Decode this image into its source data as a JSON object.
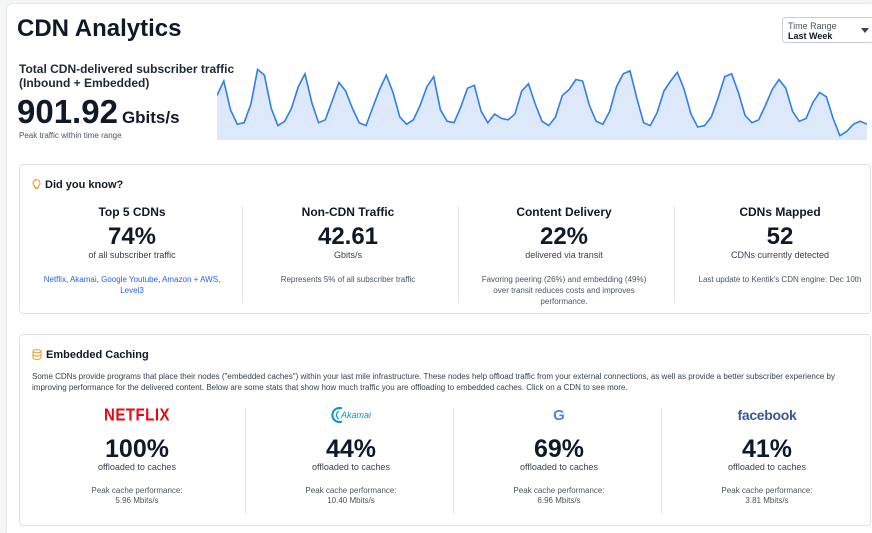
{
  "header": {
    "title": "CDN Analytics",
    "time_range": {
      "label": "Time Range",
      "value": "Last Week"
    }
  },
  "traffic": {
    "title_line1": "Total CDN-delivered subscriber traffic",
    "title_line2": "(Inbound + Embedded)",
    "value": "901.92",
    "unit": "Gbits/s",
    "caption": "Peak traffic within time range",
    "series": [
      0.62,
      0.82,
      0.42,
      0.22,
      0.24,
      0.5,
      0.98,
      0.9,
      0.44,
      0.2,
      0.26,
      0.44,
      0.74,
      0.92,
      0.52,
      0.24,
      0.28,
      0.54,
      0.8,
      0.68,
      0.44,
      0.24,
      0.2,
      0.45,
      0.7,
      0.9,
      0.66,
      0.32,
      0.22,
      0.28,
      0.48,
      0.74,
      0.88,
      0.42,
      0.26,
      0.24,
      0.46,
      0.72,
      0.76,
      0.4,
      0.24,
      0.36,
      0.3,
      0.28,
      0.36,
      0.68,
      0.78,
      0.5,
      0.26,
      0.2,
      0.32,
      0.62,
      0.7,
      0.84,
      0.82,
      0.48,
      0.26,
      0.22,
      0.4,
      0.74,
      0.92,
      0.96,
      0.58,
      0.24,
      0.2,
      0.38,
      0.68,
      0.82,
      0.94,
      0.7,
      0.36,
      0.18,
      0.2,
      0.32,
      0.58,
      0.88,
      0.92,
      0.66,
      0.34,
      0.24,
      0.28,
      0.48,
      0.7,
      0.84,
      0.72,
      0.4,
      0.26,
      0.3,
      0.52,
      0.66,
      0.6,
      0.3,
      0.06,
      0.12,
      0.22,
      0.26,
      0.22
    ],
    "colors": {
      "line": "#2f7fe6",
      "fill": "#dde9fb"
    }
  },
  "did_you_know": {
    "title": "Did you know?",
    "icon": "lightbulb-icon",
    "stats": [
      {
        "title": "Top 5 CDNs",
        "value": "74%",
        "sub": "of all subscriber traffic",
        "links": [
          {
            "label": "Netflix",
            "sep": ", "
          },
          {
            "label": "Akamai",
            "sep": ", "
          },
          {
            "label": "Google Youtube",
            "sep": ", "
          },
          {
            "label": "Amazon + AWS",
            "sep": ", "
          },
          {
            "label": "Level3",
            "sep": ""
          }
        ]
      },
      {
        "title": "Non-CDN Traffic",
        "value": "42.61",
        "sub": "Gbits/s",
        "desc": "Represents 5% of all subscriber traffic"
      },
      {
        "title": "Content Delivery",
        "value": "22%",
        "sub": "delivered via transit",
        "desc": "Favoring peering (26%) and embedding (49%) over transit reduces costs and improves performance."
      },
      {
        "title": "CDNs Mapped",
        "value": "52",
        "sub": "CDNs currently detected",
        "desc": "Last update to Kentik's CDN engine: Dec 10th"
      }
    ]
  },
  "embedded_caching": {
    "title": "Embedded Caching",
    "icon": "database-icon",
    "description": "Some CDNs provide programs that place their nodes (\"embedded caches\") within your last mile infrastructure. These nodes help offload traffic from your external connections, as well as provide a better subscriber experience by improving performance for the delivered content. Below are some stats that show how much traffic you are offloading to embedded caches. Click on a CDN to see more.",
    "cdns": [
      {
        "name": "netflix",
        "logo": "NETFLIX",
        "value": "100%",
        "sub": "offloaded to caches",
        "perf_label": "Peak cache performance:",
        "perf_value": "5.96 Mbits/s",
        "color": "#e50914"
      },
      {
        "name": "akamai",
        "logo": "Akamai",
        "value": "44%",
        "sub": "offloaded to caches",
        "perf_label": "Peak cache performance:",
        "perf_value": "10.40 Mbits/s",
        "color": "#0096d6"
      },
      {
        "name": "google",
        "logo": "G",
        "value": "69%",
        "sub": "offloaded to caches",
        "perf_label": "Peak cache performance:",
        "perf_value": "6.96 Mbits/s",
        "color": "#4285f4"
      },
      {
        "name": "facebook",
        "logo": "facebook",
        "value": "41%",
        "sub": "offloaded to caches",
        "perf_label": "Peak cache performance:",
        "perf_value": "3.81 Mbits/s",
        "color": "#3b5998"
      }
    ]
  }
}
